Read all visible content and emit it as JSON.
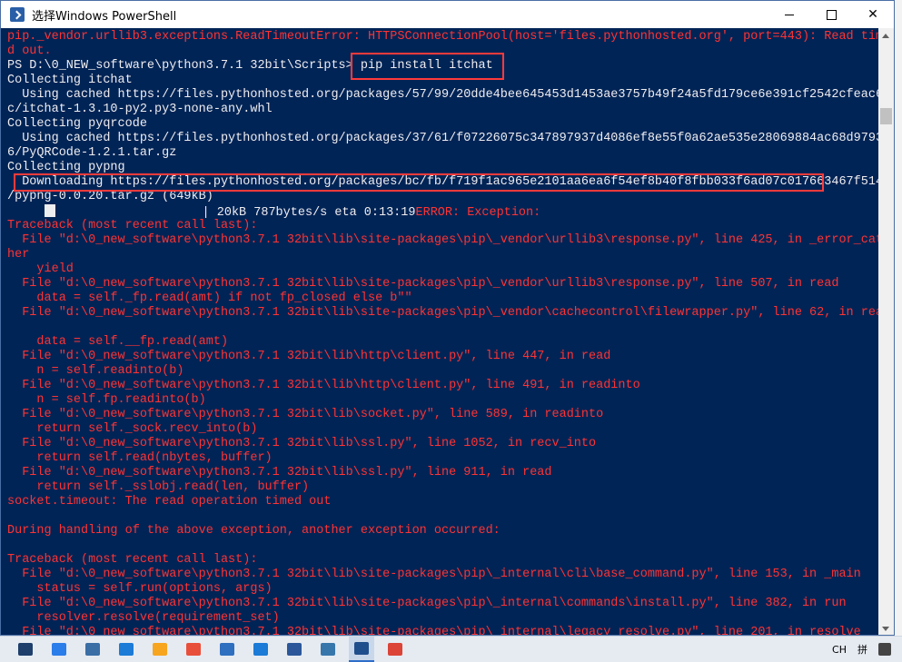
{
  "window": {
    "title": "选择Windows PowerShell",
    "minimize_label": "",
    "maximize_label": "",
    "close_label": "✕"
  },
  "console": {
    "lines": [
      {
        "t": "pip._vendor.urllib3.exceptions.ReadTimeoutError: HTTPSConnectionPool(host='files.pythonhosted.org', port=443): Read timeout",
        "c": "r"
      },
      {
        "t": "d out.",
        "c": "r"
      },
      {
        "t": "PS D:\\0_NEW_software\\python3.7.1 32bit\\Scripts> pip install itchat",
        "c": "w"
      },
      {
        "t": "Collecting itchat",
        "c": "w"
      },
      {
        "t": "  Using cached https://files.pythonhosted.org/packages/57/99/20dde4bee645453d1453ae3757b49f24a5fd179ce6e391cf2542cfeac61",
        "c": "w"
      },
      {
        "t": "c/itchat-1.3.10-py2.py3-none-any.whl",
        "c": "w"
      },
      {
        "t": "Collecting pyqrcode",
        "c": "w"
      },
      {
        "t": "  Using cached https://files.pythonhosted.org/packages/37/61/f07226075c347897937d4086ef8e55f0a62ae535e28069884ac68d97931",
        "c": "w"
      },
      {
        "t": "6/PyQRCode-1.2.1.tar.gz",
        "c": "w"
      },
      {
        "t": "Collecting pypng",
        "c": "w"
      },
      {
        "t": "  Downloading https://files.pythonhosted.org/packages/bc/fb/f719f1ac965e2101aa6ea6f54ef8b40f8fbb033f6ad07c017663467f5147",
        "c": "w"
      },
      {
        "t": "/pypng-0.0.20.tar.gz (649kB)",
        "c": "w"
      },
      {
        "t": "__PROGRESS__",
        "c": "w"
      },
      {
        "t": "Traceback (most recent call last):",
        "c": "r"
      },
      {
        "t": "  File \"d:\\0_new_software\\python3.7.1 32bit\\lib\\site-packages\\pip\\_vendor\\urllib3\\response.py\", line 425, in _error_catc",
        "c": "r"
      },
      {
        "t": "her",
        "c": "r"
      },
      {
        "t": "    yield",
        "c": "r"
      },
      {
        "t": "  File \"d:\\0_new_software\\python3.7.1 32bit\\lib\\site-packages\\pip\\_vendor\\urllib3\\response.py\", line 507, in read",
        "c": "r"
      },
      {
        "t": "    data = self._fp.read(amt) if not fp_closed else b\"\"",
        "c": "r"
      },
      {
        "t": "  File \"d:\\0_new_software\\python3.7.1 32bit\\lib\\site-packages\\pip\\_vendor\\cachecontrol\\filewrapper.py\", line 62, in read",
        "c": "r"
      },
      {
        "t": "",
        "c": "r"
      },
      {
        "t": "    data = self.__fp.read(amt)",
        "c": "r"
      },
      {
        "t": "  File \"d:\\0_new_software\\python3.7.1 32bit\\lib\\http\\client.py\", line 447, in read",
        "c": "r"
      },
      {
        "t": "    n = self.readinto(b)",
        "c": "r"
      },
      {
        "t": "  File \"d:\\0_new_software\\python3.7.1 32bit\\lib\\http\\client.py\", line 491, in readinto",
        "c": "r"
      },
      {
        "t": "    n = self.fp.readinto(b)",
        "c": "r"
      },
      {
        "t": "  File \"d:\\0_new_software\\python3.7.1 32bit\\lib\\socket.py\", line 589, in readinto",
        "c": "r"
      },
      {
        "t": "    return self._sock.recv_into(b)",
        "c": "r"
      },
      {
        "t": "  File \"d:\\0_new_software\\python3.7.1 32bit\\lib\\ssl.py\", line 1052, in recv_into",
        "c": "r"
      },
      {
        "t": "    return self.read(nbytes, buffer)",
        "c": "r"
      },
      {
        "t": "  File \"d:\\0_new_software\\python3.7.1 32bit\\lib\\ssl.py\", line 911, in read",
        "c": "r"
      },
      {
        "t": "    return self._sslobj.read(len, buffer)",
        "c": "r"
      },
      {
        "t": "socket.timeout: The read operation timed out",
        "c": "r"
      },
      {
        "t": "",
        "c": "r"
      },
      {
        "t": "During handling of the above exception, another exception occurred:",
        "c": "r"
      },
      {
        "t": "",
        "c": "r"
      },
      {
        "t": "Traceback (most recent call last):",
        "c": "r"
      },
      {
        "t": "  File \"d:\\0_new_software\\python3.7.1 32bit\\lib\\site-packages\\pip\\_internal\\cli\\base_command.py\", line 153, in _main",
        "c": "r"
      },
      {
        "t": "    status = self.run(options, args)",
        "c": "r"
      },
      {
        "t": "  File \"d:\\0_new_software\\python3.7.1 32bit\\lib\\site-packages\\pip\\_internal\\commands\\install.py\", line 382, in run",
        "c": "r"
      },
      {
        "t": "    resolver.resolve(requirement_set)",
        "c": "r"
      },
      {
        "t": "  File \"d:\\0_new_software\\python3.7.1 32bit\\lib\\site-packages\\pip\\_internal\\legacy_resolve.py\", line 201, in resolve",
        "c": "r"
      }
    ],
    "progress": {
      "stats": "| 20kB 787bytes/s eta 0:13:19",
      "error": "ERROR: Exception:"
    }
  },
  "colors": {
    "console_bg": "#012456",
    "text": "#eeedf0",
    "error": "#ff3333",
    "highlight": "#ff3b3b"
  },
  "taskbar": {
    "icons": [
      {
        "name": "mail-icon",
        "color": "#1e3f6b"
      },
      {
        "name": "check-icon",
        "color": "#2b7de9"
      },
      {
        "name": "store-icon",
        "color": "#3a6ea5"
      },
      {
        "name": "star-app-icon",
        "color": "#1b7bd6"
      },
      {
        "name": "media-player-icon",
        "color": "#f7a51e"
      },
      {
        "name": "paint-icon",
        "color": "#e84f3a"
      },
      {
        "name": "window-app-icon",
        "color": "#2f6fbf"
      },
      {
        "name": "star-app-2-icon",
        "color": "#1b7bd6"
      },
      {
        "name": "word-icon",
        "color": "#2b579a"
      },
      {
        "name": "python-icon",
        "color": "#3776ab"
      },
      {
        "name": "powershell-icon",
        "color": "#1f4e8c"
      },
      {
        "name": "chrome-icon",
        "color": "#db4437"
      }
    ],
    "tray": {
      "language": "CH",
      "ime": "拼"
    }
  }
}
